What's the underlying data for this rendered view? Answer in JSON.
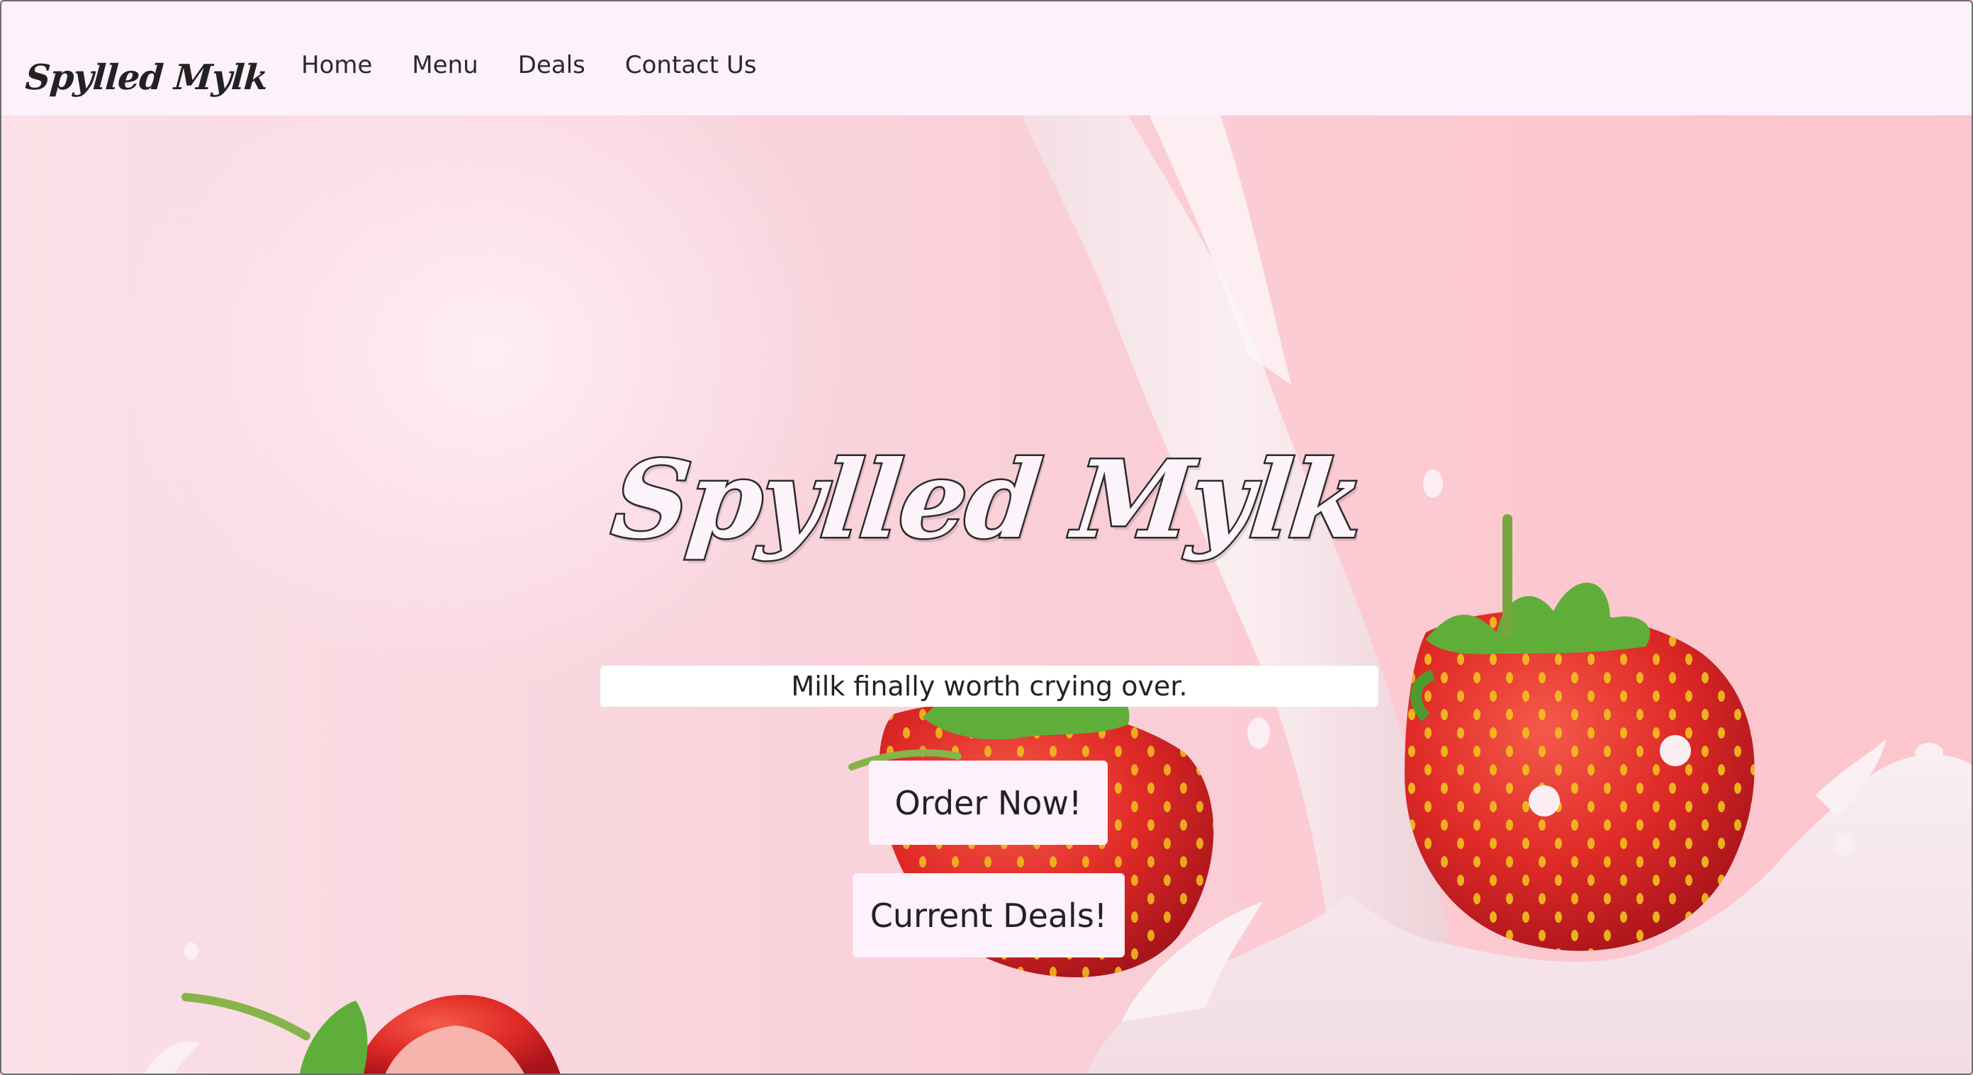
{
  "nav": {
    "brand": "Spylled Mylk",
    "links": [
      "Home",
      "Menu",
      "Deals",
      "Contact Us"
    ]
  },
  "hero": {
    "title": "Spylled Mylk",
    "tagline": "Milk finally worth crying over.",
    "order_button": "Order Now!",
    "deals_button": "Current Deals!",
    "background_image": "strawberries-milk-splash"
  },
  "colors": {
    "nav_background": "#fdf1fb",
    "hero_pink": "#f9d3dc",
    "text": "#222222",
    "strawberry_red": "#e2322c",
    "leaf_green": "#5fae3a",
    "milk": "#f7e9ee"
  }
}
